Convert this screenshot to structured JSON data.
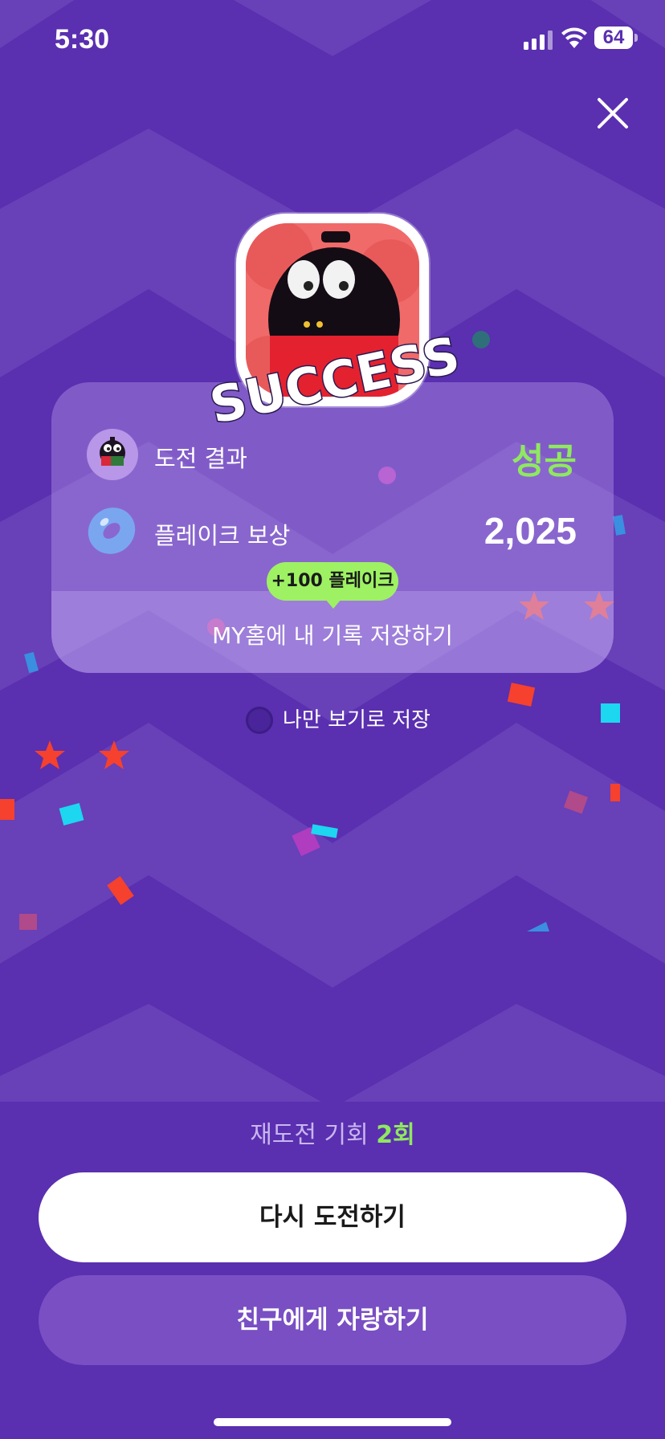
{
  "status_bar": {
    "time": "5:30",
    "battery": "64"
  },
  "result_card": {
    "result_label": "도전 결과",
    "result_value": "성공",
    "reward_label": "플레이크 보상",
    "reward_value": "2,025",
    "bonus_badge": "+100 플레이크",
    "save_link": "MY홈에 내 기록 저장하기"
  },
  "banner_text": "SUCCESS",
  "private_save": {
    "label": "나만 보기로 저장",
    "checked": false
  },
  "retry": {
    "label": "재도전 기회",
    "count": "2회"
  },
  "buttons": {
    "retry": "다시 도전하기",
    "share": "친구에게 자랑하기"
  },
  "colors": {
    "background": "#5a2fb0",
    "accent_green": "#8fe85f",
    "badge_green": "#9ef163"
  }
}
